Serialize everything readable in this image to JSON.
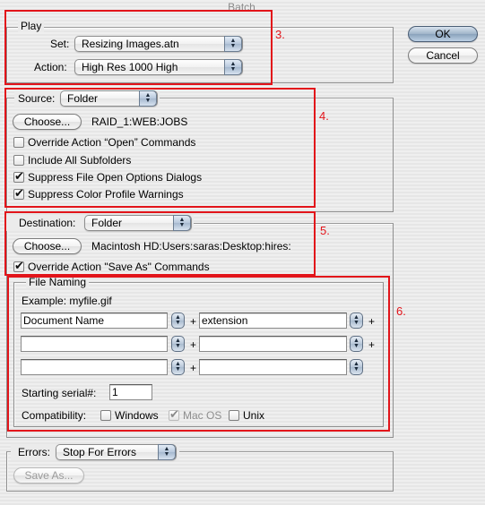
{
  "window": {
    "title": "Batch"
  },
  "buttons": {
    "ok": "OK",
    "cancel": "Cancel"
  },
  "play": {
    "legend": "Play",
    "set_label": "Set:",
    "set_value": "Resizing Images.atn",
    "action_label": "Action:",
    "action_value": "High Res 1000 High"
  },
  "source": {
    "label": "Source:",
    "value": "Folder",
    "choose_label": "Choose...",
    "path": "RAID_1:WEB:JOBS",
    "options": [
      {
        "label": "Override Action “Open” Commands",
        "checked": false
      },
      {
        "label": "Include All Subfolders",
        "checked": false
      },
      {
        "label": "Suppress File Open Options Dialogs",
        "checked": true
      },
      {
        "label": "Suppress Color Profile Warnings",
        "checked": true
      }
    ]
  },
  "destination": {
    "label": "Destination:",
    "value": "Folder",
    "choose_label": "Choose...",
    "path": "Macintosh HD:Users:saras:Desktop:hires:",
    "override_label": "Override Action \"Save As\" Commands",
    "override_checked": true
  },
  "file_naming": {
    "legend": "File Naming",
    "example": "Example: myfile.gif",
    "fields": [
      [
        "Document Name",
        "extension"
      ],
      [
        "",
        ""
      ],
      [
        "",
        ""
      ]
    ],
    "plus": "+",
    "serial_label": "Starting serial#:",
    "serial_value": "1",
    "compat_label": "Compatibility:",
    "compat": [
      {
        "label": "Windows",
        "checked": false,
        "disabled": false
      },
      {
        "label": "Mac OS",
        "checked": true,
        "disabled": true
      },
      {
        "label": "Unix",
        "checked": false,
        "disabled": false
      }
    ]
  },
  "errors": {
    "label": "Errors:",
    "value": "Stop For Errors",
    "save_as_label": "Save As..."
  },
  "annotations": [
    "3.",
    "4.",
    "5.",
    "6."
  ],
  "icons": {
    "check": "✔",
    "stepper": "▲▼"
  },
  "colors": {
    "annotation_red": "#e2141a",
    "default_button": "#9fb4c9"
  }
}
